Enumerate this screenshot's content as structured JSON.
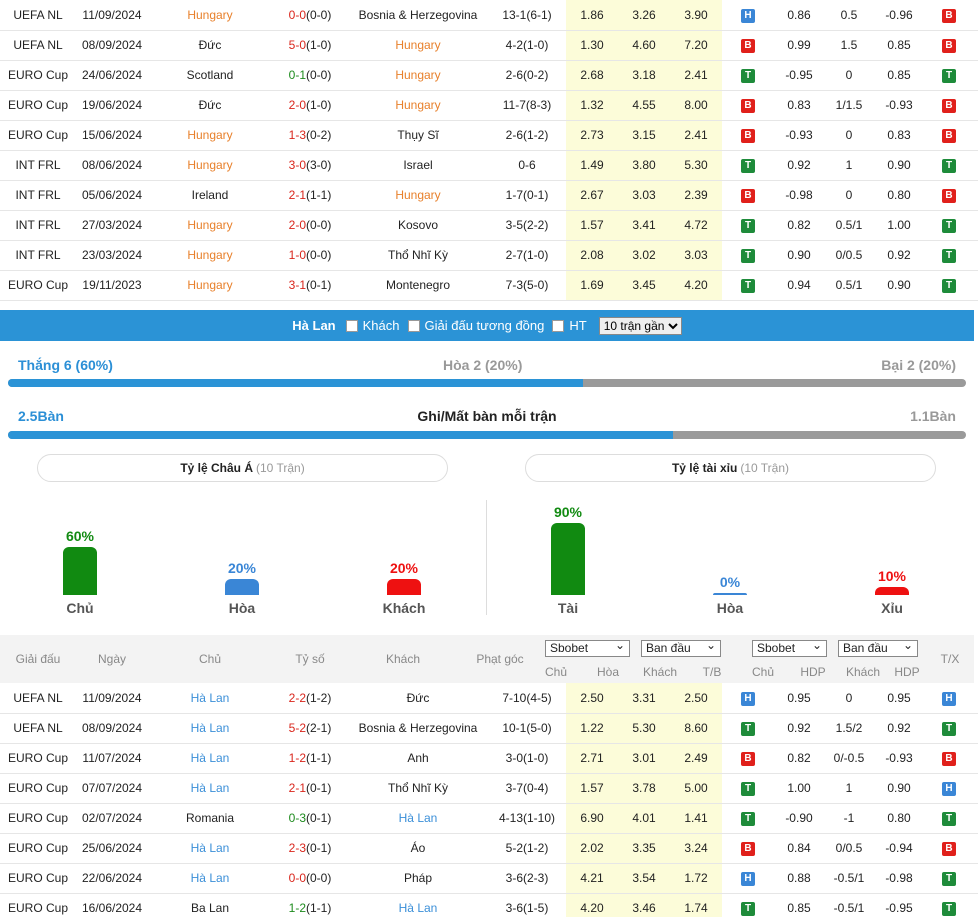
{
  "top_rows": [
    {
      "league": "UEFA NL",
      "date": "11/09/2024",
      "home": "Hungary",
      "home_hl": true,
      "score": "0-0",
      "ht": "(0-0)",
      "score_class": "s-draw",
      "away": "Bosnia & Herzegovina",
      "away_hl": false,
      "corner": "13-1(6-1)",
      "o1": "1.86",
      "o2": "3.26",
      "o3": "3.90",
      "r1": "H",
      "h1": "0.86",
      "h2": "0.5",
      "h3": "-0.96",
      "r2": "B",
      "r3": "X"
    },
    {
      "league": "UEFA NL",
      "date": "08/09/2024",
      "home": "Đức",
      "home_hl": false,
      "score": "5-0",
      "ht": "(1-0)",
      "score_class": "s-win",
      "away": "Hungary",
      "away_hl": true,
      "corner": "4-2(1-0)",
      "o1": "1.30",
      "o2": "4.60",
      "o3": "7.20",
      "r1": "B",
      "h1": "0.99",
      "h2": "1.5",
      "h3": "0.85",
      "r2": "B",
      "r3": "T"
    },
    {
      "league": "EURO Cup",
      "date": "24/06/2024",
      "home": "Scotland",
      "home_hl": false,
      "score": "0-1",
      "ht": "(0-0)",
      "score_class": "s-lose",
      "away": "Hungary",
      "away_hl": true,
      "corner": "2-6(0-2)",
      "o1": "2.68",
      "o2": "3.18",
      "o3": "2.41",
      "r1": "T",
      "h1": "-0.95",
      "h2": "0",
      "h3": "0.85",
      "r2": "T",
      "r3": "X"
    },
    {
      "league": "EURO Cup",
      "date": "19/06/2024",
      "home": "Đức",
      "home_hl": false,
      "score": "2-0",
      "ht": "(1-0)",
      "score_class": "s-win",
      "away": "Hungary",
      "away_hl": true,
      "corner": "11-7(8-3)",
      "o1": "1.32",
      "o2": "4.55",
      "o3": "8.00",
      "r1": "B",
      "h1": "0.83",
      "h2": "1/1.5",
      "h3": "-0.93",
      "r2": "B",
      "r3": "X"
    },
    {
      "league": "EURO Cup",
      "date": "15/06/2024",
      "home": "Hungary",
      "home_hl": true,
      "score": "1-3",
      "ht": "(0-2)",
      "score_class": "s-win",
      "away": "Thụy Sĩ",
      "away_hl": false,
      "corner": "2-6(1-2)",
      "o1": "2.73",
      "o2": "3.15",
      "o3": "2.41",
      "r1": "B",
      "h1": "-0.93",
      "h2": "0",
      "h3": "0.83",
      "r2": "B",
      "r3": "T"
    },
    {
      "league": "INT FRL",
      "date": "08/06/2024",
      "home": "Hungary",
      "home_hl": true,
      "score": "3-0",
      "ht": "(3-0)",
      "score_class": "s-win",
      "away": "Israel",
      "away_hl": false,
      "corner": "0-6",
      "o1": "1.49",
      "o2": "3.80",
      "o3": "5.30",
      "r1": "T",
      "h1": "0.92",
      "h2": "1",
      "h3": "0.90",
      "r2": "T",
      "r3": "T"
    },
    {
      "league": "INT FRL",
      "date": "05/06/2024",
      "home": "Ireland",
      "home_hl": false,
      "score": "2-1",
      "ht": "(1-1)",
      "score_class": "s-win",
      "away": "Hungary",
      "away_hl": true,
      "corner": "1-7(0-1)",
      "o1": "2.67",
      "o2": "3.03",
      "o3": "2.39",
      "r1": "B",
      "h1": "-0.98",
      "h2": "0",
      "h3": "0.80",
      "r2": "B",
      "r3": "T"
    },
    {
      "league": "INT FRL",
      "date": "27/03/2024",
      "home": "Hungary",
      "home_hl": true,
      "score": "2-0",
      "ht": "(0-0)",
      "score_class": "s-win",
      "away": "Kosovo",
      "away_hl": false,
      "corner": "3-5(2-2)",
      "o1": "1.57",
      "o2": "3.41",
      "o3": "4.72",
      "r1": "T",
      "h1": "0.82",
      "h2": "0.5/1",
      "h3": "1.00",
      "r2": "T",
      "r3": "X"
    },
    {
      "league": "INT FRL",
      "date": "23/03/2024",
      "home": "Hungary",
      "home_hl": true,
      "score": "1-0",
      "ht": "(0-0)",
      "score_class": "s-win",
      "away": "Thổ Nhĩ Kỳ",
      "away_hl": false,
      "corner": "2-7(1-0)",
      "o1": "2.08",
      "o2": "3.02",
      "o3": "3.03",
      "r1": "T",
      "h1": "0.90",
      "h2": "0/0.5",
      "h3": "0.92",
      "r2": "T",
      "r3": "X"
    },
    {
      "league": "EURO Cup",
      "date": "19/11/2023",
      "home": "Hungary",
      "home_hl": true,
      "score": "3-1",
      "ht": "(0-1)",
      "score_class": "s-win",
      "away": "Montenegro",
      "away_hl": false,
      "corner": "7-3(5-0)",
      "o1": "1.69",
      "o2": "3.45",
      "o3": "4.20",
      "r1": "T",
      "h1": "0.94",
      "h2": "0.5/1",
      "h3": "0.90",
      "r2": "T",
      "r3": "T"
    }
  ],
  "filter": {
    "team": "Hà Lan",
    "away_label": "Khách",
    "same_league_label": "Giải đấu tương đồng",
    "ht_label": "HT",
    "matches_option": "10 trận gần"
  },
  "summary": {
    "win": "Thắng 6 (60%)",
    "draw": "Hòa 2 (20%)",
    "loss": "Bại 2 (20%)",
    "win_pct": 60,
    "goals_for": "2.5Bàn",
    "goals_title": "Ghi/Mất bàn mỗi trận",
    "goals_against": "1.1Bàn",
    "goals_for_frac": 0.694
  },
  "asian": {
    "title": "Tỷ lệ Châu Á",
    "count": "(10 Trận)",
    "bars": [
      {
        "pct": "60%",
        "label": "Chủ",
        "value": 60,
        "color": "#118a11"
      },
      {
        "pct": "20%",
        "label": "Hòa",
        "value": 20,
        "color": "#3a86d6"
      },
      {
        "pct": "20%",
        "label": "Khách",
        "value": 20,
        "color": "#ee1111"
      }
    ]
  },
  "ou": {
    "title": "Tỷ lệ tài xỉu",
    "count": "(10 Trận)",
    "bars": [
      {
        "pct": "90%",
        "label": "Tài",
        "value": 90,
        "color": "#118a11"
      },
      {
        "pct": "0%",
        "label": "Hòa",
        "value": 0,
        "color": "#3a86d6"
      },
      {
        "pct": "10%",
        "label": "Xỉu",
        "value": 10,
        "color": "#ee1111"
      }
    ]
  },
  "bottom_header": {
    "league": "Giải đấu",
    "date": "Ngày",
    "home": "Chủ",
    "score": "Tỷ số",
    "away": "Khách",
    "corner": "Phạt góc",
    "book1": "Sbobet",
    "type1": "Ban đầu",
    "book2": "Sbobet",
    "type2": "Ban đầu",
    "c_home": "Chủ",
    "c_draw": "Hòa",
    "c_away": "Khách",
    "c_tb": "T/B",
    "c_home2": "Chủ",
    "c_hdp": "HDP",
    "c_away2": "Khách",
    "c_hdp2": "HDP",
    "c_tx": "T/X"
  },
  "bottom_rows": [
    {
      "league": "UEFA NL",
      "date": "11/09/2024",
      "home": "Hà Lan",
      "home_hl": true,
      "score": "2-2",
      "ht": "(1-2)",
      "score_class": "s-draw",
      "away": "Đức",
      "away_hl": false,
      "corner": "7-10(4-5)",
      "o1": "2.50",
      "o2": "3.31",
      "o3": "2.50",
      "r1": "H",
      "h1": "0.95",
      "h2": "0",
      "h3": "0.95",
      "r2": "H",
      "r3": "T"
    },
    {
      "league": "UEFA NL",
      "date": "08/09/2024",
      "home": "Hà Lan",
      "home_hl": true,
      "score": "5-2",
      "ht": "(2-1)",
      "score_class": "s-win",
      "away": "Bosnia & Herzegovina",
      "away_hl": false,
      "corner": "10-1(5-0)",
      "o1": "1.22",
      "o2": "5.30",
      "o3": "8.60",
      "r1": "T",
      "h1": "0.92",
      "h2": "1.5/2",
      "h3": "0.92",
      "r2": "T",
      "r3": "T"
    },
    {
      "league": "EURO Cup",
      "date": "11/07/2024",
      "home": "Hà Lan",
      "home_hl": true,
      "score": "1-2",
      "ht": "(1-1)",
      "score_class": "s-win",
      "away": "Anh",
      "away_hl": false,
      "corner": "3-0(1-0)",
      "o1": "2.71",
      "o2": "3.01",
      "o3": "2.49",
      "r1": "B",
      "h1": "0.82",
      "h2": "0/-0.5",
      "h3": "-0.93",
      "r2": "B",
      "r3": "T"
    },
    {
      "league": "EURO Cup",
      "date": "07/07/2024",
      "home": "Hà Lan",
      "home_hl": true,
      "score": "2-1",
      "ht": "(0-1)",
      "score_class": "s-win",
      "away": "Thổ Nhĩ Kỳ",
      "away_hl": false,
      "corner": "3-7(0-4)",
      "o1": "1.57",
      "o2": "3.78",
      "o3": "5.00",
      "r1": "T",
      "h1": "1.00",
      "h2": "1",
      "h3": "0.90",
      "r2": "H",
      "r3": "T"
    },
    {
      "league": "EURO Cup",
      "date": "02/07/2024",
      "home": "Romania",
      "home_hl": false,
      "score": "0-3",
      "ht": "(0-1)",
      "score_class": "s-lose",
      "away": "Hà Lan",
      "away_hl": true,
      "corner": "4-13(1-10)",
      "o1": "6.90",
      "o2": "4.01",
      "o3": "1.41",
      "r1": "T",
      "h1": "-0.90",
      "h2": "-1",
      "h3": "0.80",
      "r2": "T",
      "r3": "T"
    },
    {
      "league": "EURO Cup",
      "date": "25/06/2024",
      "home": "Hà Lan",
      "home_hl": true,
      "score": "2-3",
      "ht": "(0-1)",
      "score_class": "s-win",
      "away": "Áo",
      "away_hl": false,
      "corner": "5-2(1-2)",
      "o1": "2.02",
      "o2": "3.35",
      "o3": "3.24",
      "r1": "B",
      "h1": "0.84",
      "h2": "0/0.5",
      "h3": "-0.94",
      "r2": "B",
      "r3": "T"
    },
    {
      "league": "EURO Cup",
      "date": "22/06/2024",
      "home": "Hà Lan",
      "home_hl": true,
      "score": "0-0",
      "ht": "(0-0)",
      "score_class": "s-draw",
      "away": "Pháp",
      "away_hl": false,
      "corner": "3-6(2-3)",
      "o1": "4.21",
      "o2": "3.54",
      "o3": "1.72",
      "r1": "H",
      "h1": "0.88",
      "h2": "-0.5/1",
      "h3": "-0.98",
      "r2": "T",
      "r3": "X"
    },
    {
      "league": "EURO Cup",
      "date": "16/06/2024",
      "home": "Ba Lan",
      "home_hl": false,
      "score": "1-2",
      "ht": "(1-1)",
      "score_class": "s-lose",
      "away": "Hà Lan",
      "away_hl": true,
      "corner": "3-6(1-5)",
      "o1": "4.20",
      "o2": "3.46",
      "o3": "1.74",
      "r1": "T",
      "h1": "0.85",
      "h2": "-0.5/1",
      "h3": "-0.95",
      "r2": "T",
      "r3": "T"
    }
  ]
}
